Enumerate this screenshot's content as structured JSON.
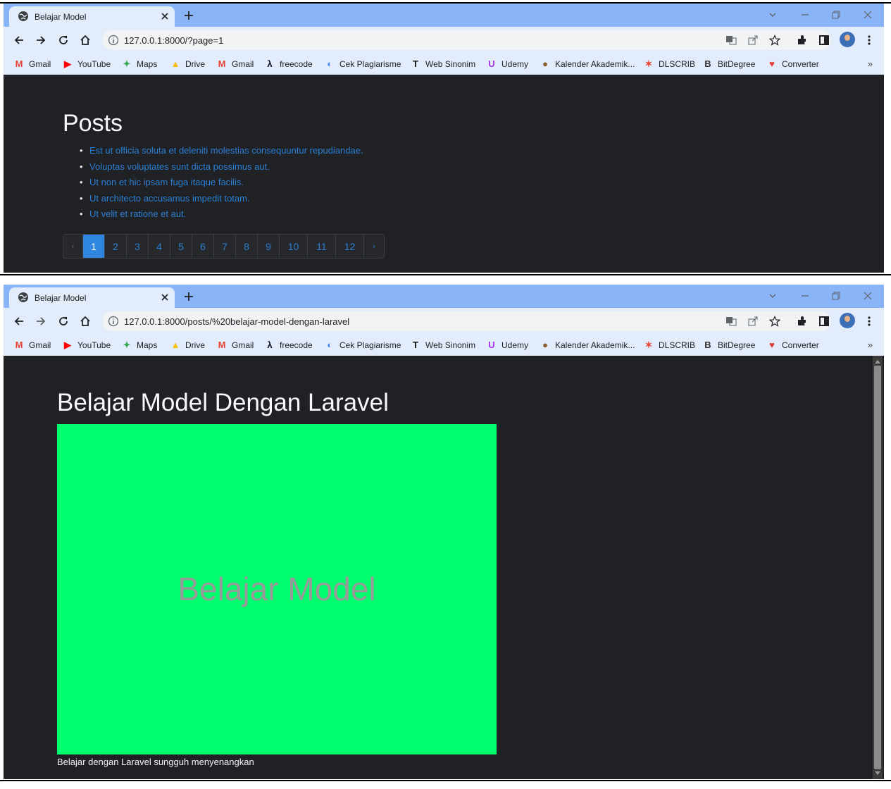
{
  "browser": {
    "tab_title": "Belajar Model",
    "bookmarks": [
      {
        "label": "Gmail",
        "icon": "gmail-icon",
        "color": "#ea4335"
      },
      {
        "label": "YouTube",
        "icon": "youtube-icon",
        "color": "#ff0000"
      },
      {
        "label": "Maps",
        "icon": "maps-icon",
        "color": "#34a853"
      },
      {
        "label": "Drive",
        "icon": "drive-icon",
        "color": "#fbbc04"
      },
      {
        "label": "Gmail",
        "icon": "gmail-icon",
        "color": "#ea4335"
      },
      {
        "label": "freecode",
        "icon": "freecodecamp-icon",
        "color": "#0a0a23"
      },
      {
        "label": "Cek Plagiarisme",
        "icon": "plagiarism-icon",
        "color": "#4285f4"
      },
      {
        "label": "Web Sinonim",
        "icon": "sinonim-icon",
        "color": "#111111"
      },
      {
        "label": "Udemy",
        "icon": "udemy-icon",
        "color": "#a435f0"
      },
      {
        "label": "Kalender Akademik...",
        "icon": "university-icon",
        "color": "#8a5a2b"
      },
      {
        "label": "DLSCRIB",
        "icon": "dlscrib-icon",
        "color": "#e8453c"
      },
      {
        "label": "BitDegree",
        "icon": "bitdegree-icon",
        "color": "#333333"
      },
      {
        "label": "Converter",
        "icon": "converter-icon",
        "color": "#e53935"
      }
    ],
    "more_label": "»"
  },
  "screen1": {
    "url": "127.0.0.1:8000/?page=1",
    "heading": "Posts",
    "posts": [
      "Est ut officia soluta et deleniti molestias consequuntur repudiandae.",
      "Voluptas voluptates sunt dicta possimus aut.",
      "Ut non et hic ipsam fuga itaque facilis.",
      "Ut architecto accusamus impedit totam.",
      "Ut velit et ratione et aut."
    ],
    "pagination": {
      "prev": "‹",
      "pages": [
        "1",
        "2",
        "3",
        "4",
        "5",
        "6",
        "7",
        "8",
        "9",
        "10",
        "11",
        "12"
      ],
      "active_page": "1",
      "next": "›"
    }
  },
  "screen2": {
    "url": "127.0.0.1:8000/posts/%20belajar-model-dengan-laravel",
    "title": "Belajar Model Dengan Laravel",
    "image_text": "Belajar Model",
    "image_bg": "#00ff6e",
    "body": "Belajar dengan Laravel sungguh menyenangkan"
  },
  "colors": {
    "tab_strip": "#8ab4f8",
    "toolbar": "#e3ecfb",
    "page_bg": "#202124",
    "link": "#2d7fd3",
    "active_page": "#2e86de"
  }
}
